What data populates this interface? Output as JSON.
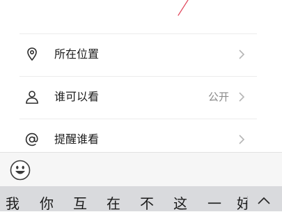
{
  "menu": {
    "items": [
      {
        "label": "所在位置",
        "value": "",
        "icon": "location-pin-icon"
      },
      {
        "label": "谁可以看",
        "value": "公开",
        "icon": "person-icon"
      },
      {
        "label": "提醒谁看",
        "value": "",
        "icon": "at-sign-icon"
      }
    ]
  },
  "emoji_bar": {
    "icon": "smiley-face-icon"
  },
  "keyboard": {
    "candidates": [
      "我",
      "你",
      "互",
      "在",
      "不",
      "这",
      "一",
      "好"
    ],
    "collapse_icon": "chevron-up-icon"
  },
  "colors": {
    "label": "#1c1c1c",
    "value": "#8a8a8a",
    "divider": "#ececec",
    "keyboard_bg": "#d9dadd",
    "scribble": "#e0455a"
  }
}
